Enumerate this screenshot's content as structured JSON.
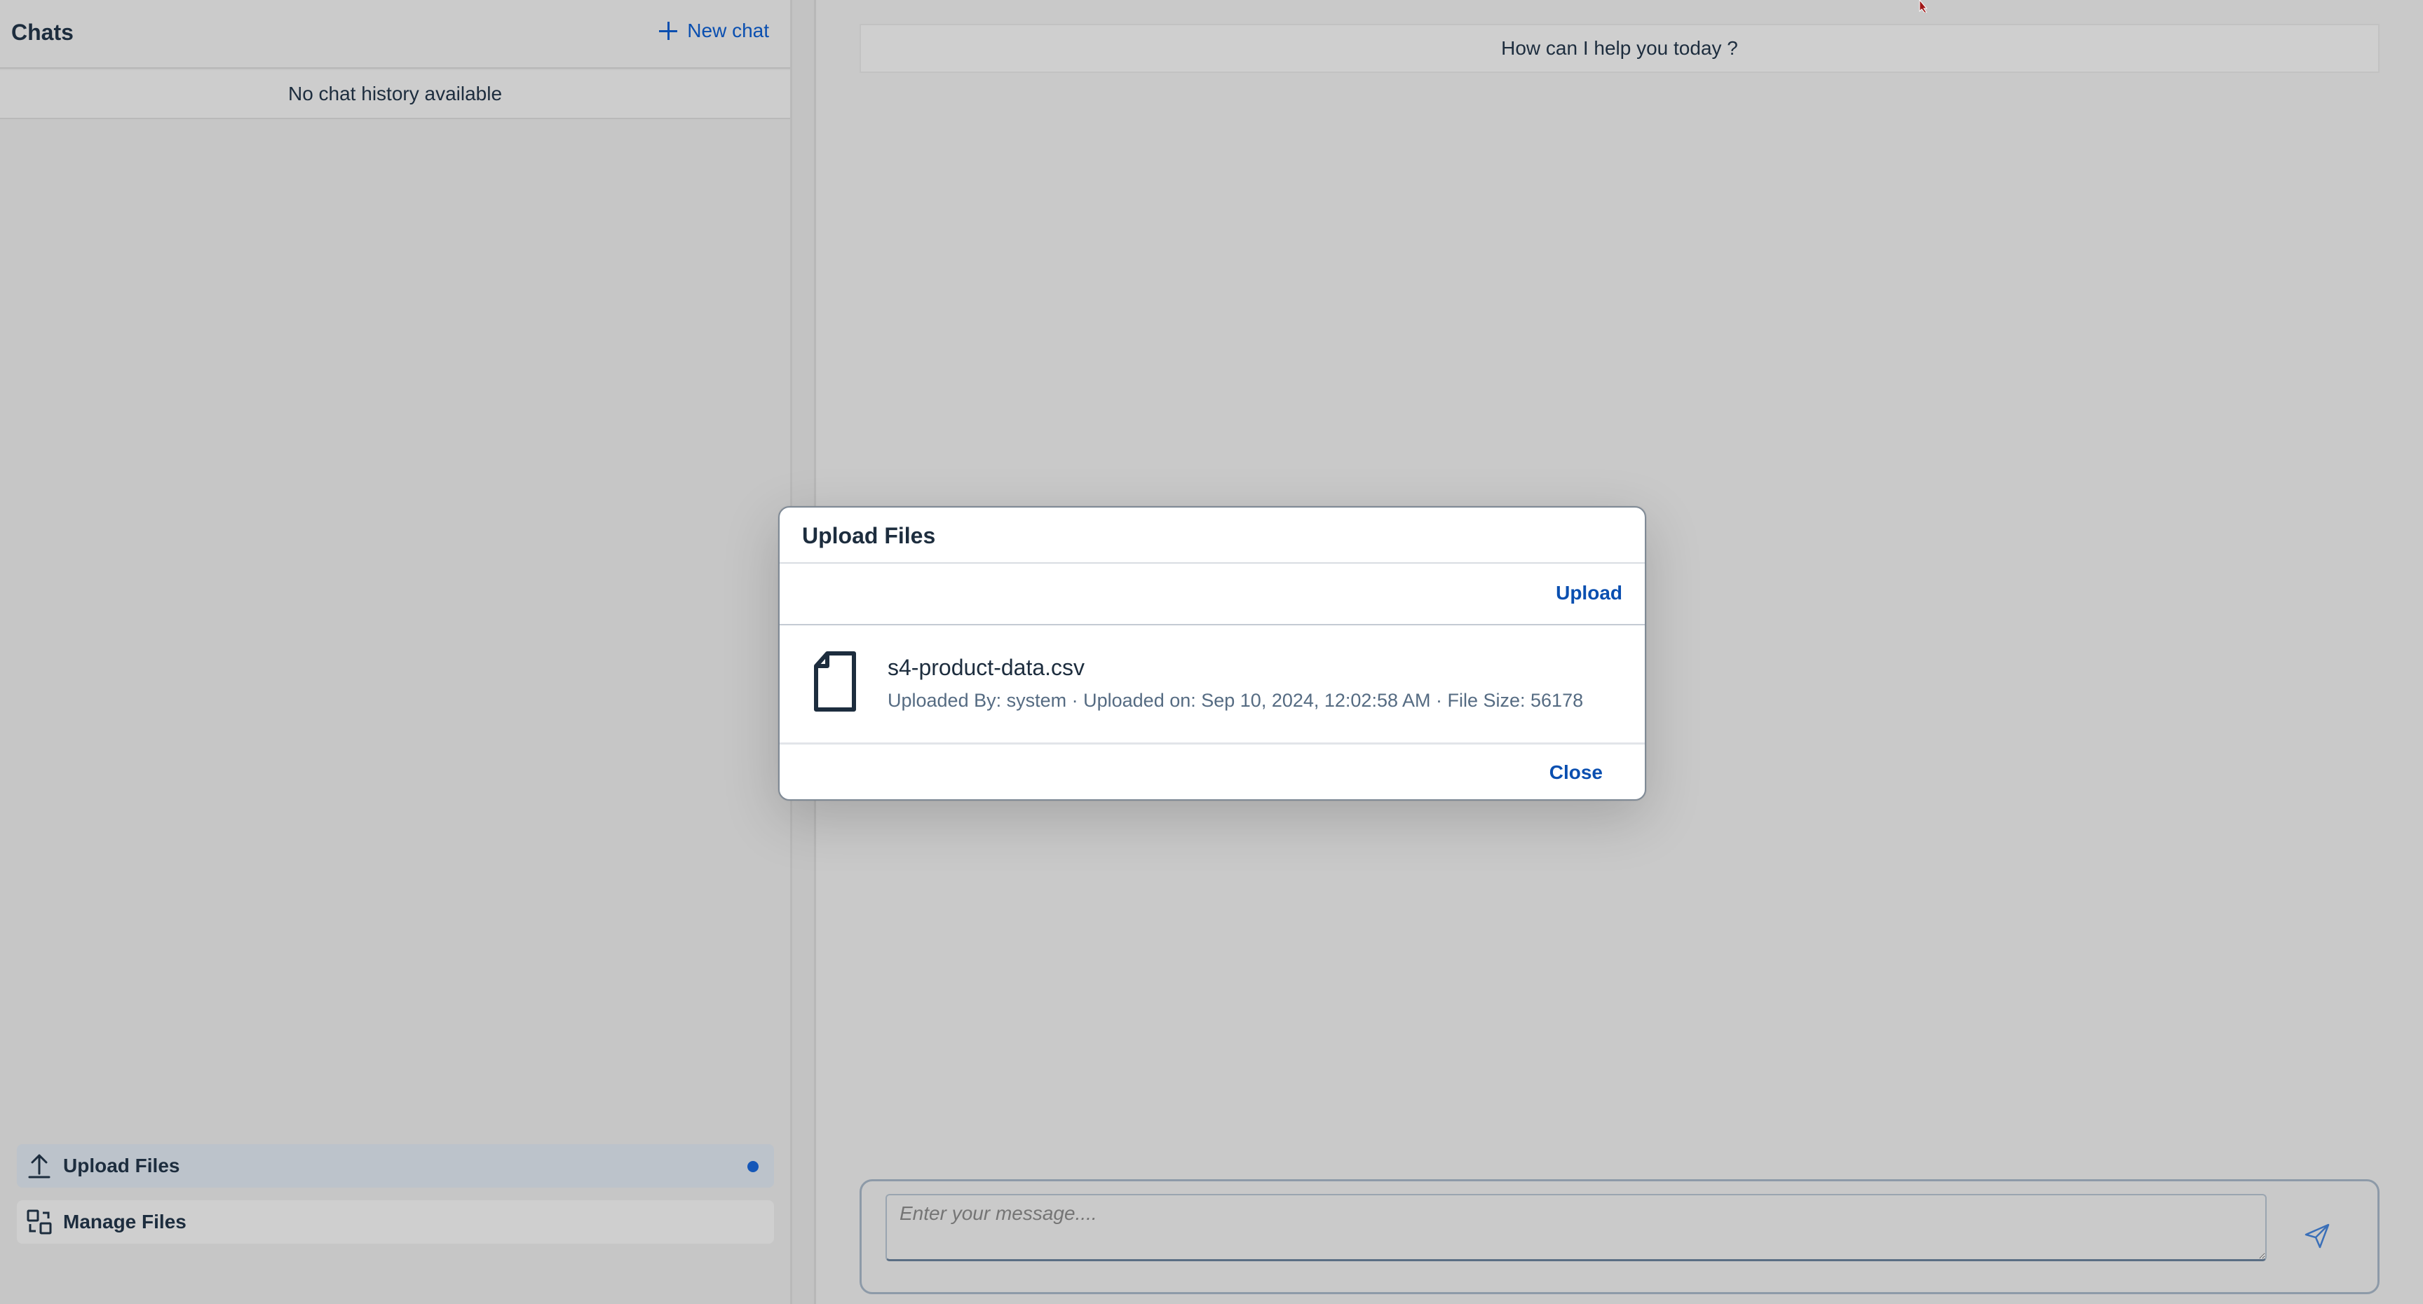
{
  "sidebar": {
    "title": "Chats",
    "new_chat_label": "New chat",
    "empty_history_text": "No chat history available",
    "nav": [
      {
        "label": "Upload Files",
        "icon": "upload-icon",
        "active": true,
        "indicator": true
      },
      {
        "label": "Manage Files",
        "icon": "manage-files-icon",
        "active": false,
        "indicator": false
      }
    ]
  },
  "main": {
    "greeting": "How can I help you today ?",
    "composer": {
      "placeholder": "Enter your message....",
      "send_icon": "send-icon"
    }
  },
  "dialog": {
    "title": "Upload Files",
    "upload_label": "Upload",
    "close_label": "Close",
    "files": [
      {
        "icon": "document-icon",
        "name": "s4-product-data.csv",
        "meta": "Uploaded By: system · Uploaded on: Sep 10, 2024, 12:02:58 AM · File Size: 56178"
      }
    ]
  },
  "colors": {
    "accent": "#0a4fb0",
    "text": "#1d2d3e",
    "muted": "#556b82",
    "overlay_bg": "#c9c9c9",
    "indicator_dot": "#1557b8"
  }
}
